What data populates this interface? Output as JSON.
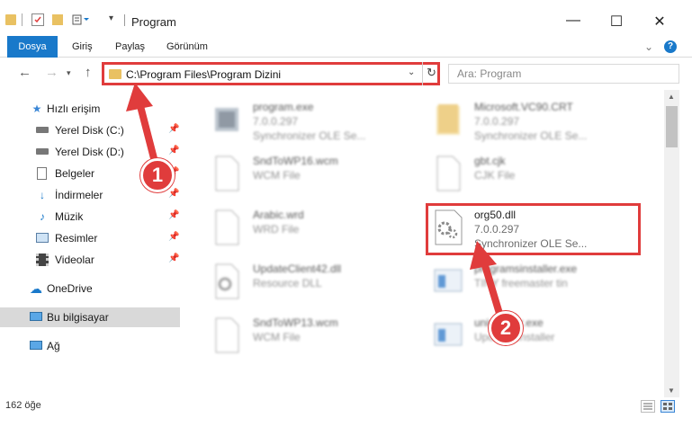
{
  "window": {
    "title": "Program"
  },
  "ribbon": {
    "tabs": [
      {
        "label": "Dosya"
      },
      {
        "label": "Giriş"
      },
      {
        "label": "Paylaş"
      },
      {
        "label": "Görünüm"
      }
    ]
  },
  "address": {
    "path": "C:\\Program Files\\Program Dizini"
  },
  "search": {
    "placeholder": "Ara: Program"
  },
  "sidebar": {
    "items": [
      {
        "label": "Hızlı erişim"
      },
      {
        "label": "Yerel Disk (C:)"
      },
      {
        "label": "Yerel Disk (D:)"
      },
      {
        "label": "Belgeler"
      },
      {
        "label": "İndirmeler"
      },
      {
        "label": "Müzik"
      },
      {
        "label": "Resimler"
      },
      {
        "label": "Videolar"
      },
      {
        "label": "OneDrive"
      },
      {
        "label": "Bu bilgisayar"
      },
      {
        "label": "Ağ"
      }
    ]
  },
  "files": [
    {
      "name": "program.exe",
      "line2": "7.0.0.297",
      "line3": "Synchronizer OLE Se..."
    },
    {
      "name": "Microsoft.VC90.CRT",
      "line2": "7.0.0.297",
      "line3": "Synchronizer OLE Se..."
    },
    {
      "name": "SndToWP16.wcm",
      "line2": "WCM File",
      "line3": ""
    },
    {
      "name": "gbt.cjk",
      "line2": "CJK File",
      "line3": ""
    },
    {
      "name": "Arabic.wrd",
      "line2": "WRD File",
      "line3": ""
    },
    {
      "name": "org50.dll",
      "line2": "7.0.0.297",
      "line3": "Synchronizer OLE Se..."
    },
    {
      "name": "UpdateClient42.dll",
      "line2": "Resource DLL",
      "line3": ""
    },
    {
      "name": "programsinstaller.exe",
      "line2": "TINY freemaster tin",
      "line3": ""
    },
    {
      "name": "SndToWP13.wcm",
      "line2": "WCM File",
      "line3": ""
    },
    {
      "name": "uninstaller.exe",
      "line2": "Updates installer",
      "line3": ""
    }
  ],
  "status": {
    "count": "162 öğe"
  },
  "annotations": {
    "badge1": "1",
    "badge2": "2",
    "color": "#e03c3c"
  },
  "colors": {
    "accent": "#1979ca",
    "folder": "#e9c162"
  }
}
